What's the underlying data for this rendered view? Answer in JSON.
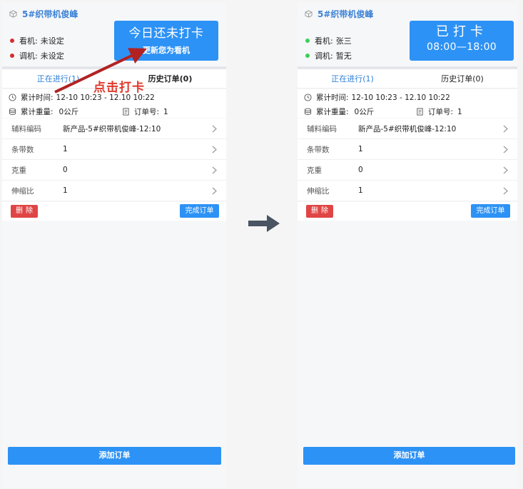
{
  "left": {
    "machine_title": "5#织带机俊峰",
    "status": [
      {
        "label": "看机:",
        "value": "未设定"
      },
      {
        "label": "调机:",
        "value": "未设定"
      }
    ],
    "dot_color": "#d32f2f",
    "clock_main": "今日还未打卡",
    "clock_sub": "更新您为看机",
    "tabs": [
      "正在进行(1)",
      "历史订单(0)"
    ],
    "summary": {
      "time_label": "累计时间:",
      "time_value": "12-10 10:23 - 12.10 10:22",
      "weight_label": "累计重量:",
      "weight_value": "0公斤",
      "order_label": "订单号:",
      "order_value": "1"
    },
    "fields": [
      {
        "name": "辅料编码",
        "value": "新产品-5#织带机俊峰-12:10"
      },
      {
        "name": "条带数",
        "value": "1"
      },
      {
        "name": "克重",
        "value": "0"
      },
      {
        "name": "伸缩比",
        "value": "1"
      }
    ],
    "delete_label": "删除",
    "complete_label": "完成订单",
    "add_label": "添加订单",
    "annotation": "点击打卡"
  },
  "right": {
    "machine_title": "5#织带机俊峰",
    "status": [
      {
        "label": "看机:",
        "value": "张三"
      },
      {
        "label": "调机:",
        "value": "暂无"
      }
    ],
    "dot_color": "#3ccf5a",
    "clock_main": "已打卡",
    "clock_sub": "08:00—18:00",
    "tabs": [
      "正在进行(1)",
      "历史订单(0)"
    ],
    "summary": {
      "time_label": "累计时间:",
      "time_value": "12-10 10:23 - 12.10 10:22",
      "weight_label": "累计重量:",
      "weight_value": "0公斤",
      "order_label": "订单号:",
      "order_value": "1"
    },
    "fields": [
      {
        "name": "辅料编码",
        "value": "新产品-5#织带机俊峰-12:10"
      },
      {
        "name": "条带数",
        "value": "1"
      },
      {
        "name": "克重",
        "value": "0"
      },
      {
        "name": "伸缩比",
        "value": "1"
      }
    ],
    "delete_label": "删除",
    "complete_label": "完成订单",
    "add_label": "添加订单"
  },
  "colors": {
    "accent": "#2d92f5",
    "danger": "#e04545",
    "annotation": "#e0392b",
    "arrow": "#4a5462"
  }
}
